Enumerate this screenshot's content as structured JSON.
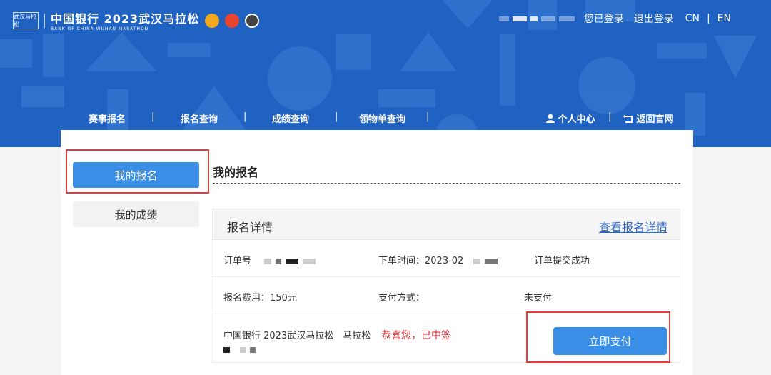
{
  "header": {
    "logo_text": "武汉马拉松",
    "bank_cn": "中国银行 2023武汉马拉松",
    "bank_en": "BANK OF CHINA  WUHAN  MARATHON",
    "login_status": "您已登录",
    "logout": "退出登录",
    "lang_cn": "CN",
    "lang_sep": "|",
    "lang_en": "EN",
    "brand_color": "#1f62c2"
  },
  "nav": {
    "items": [
      "赛事报名",
      "报名查询",
      "成绩查询",
      "领物单查询"
    ],
    "separator": "|",
    "personal_center": "个人中心",
    "back_site": "返回官网"
  },
  "sidebar": {
    "items": [
      {
        "label": "我的报名",
        "active": true
      },
      {
        "label": "我的成绩",
        "active": false
      }
    ]
  },
  "main": {
    "title": "我的报名",
    "card": {
      "title": "报名详情",
      "link": "查看报名详情",
      "order_no_label": "订单号",
      "order_time_label": "下单时间：2023-02",
      "order_status": "订单提交成功",
      "fee": "报名费用：150元",
      "pay_method": "支付方式：",
      "pay_status": "未支付",
      "event_name": "中国银行 2023武汉马拉松　马拉松",
      "lottery_result": "恭喜您，已中签",
      "pay_button": "立即支付"
    }
  },
  "colors": {
    "accent": "#3a8ee6",
    "highlight": "#e53c3c",
    "success_red": "#d9262c"
  }
}
